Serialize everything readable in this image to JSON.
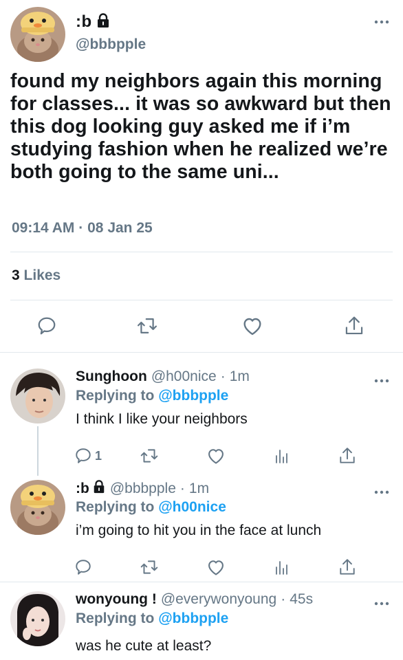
{
  "main_tweet": {
    "display_name": ":b",
    "handle": "@bbbpple",
    "text": "found my neighbors again this morning for classes... it was so awkward but then this dog looking guy asked me if i’m studying fashion when he realized we’re both going to the same uni...",
    "time": "09:14 AM",
    "date": "08 Jan 25",
    "likes_count": "3",
    "likes_label": "Likes",
    "avatar_icon": "cat-with-hat-avatar",
    "lock_icon": "lock-icon"
  },
  "replies": [
    {
      "name": "Sunghoon",
      "handle": "@h00nice",
      "time": "1m",
      "replying_prefix": "Replying to",
      "replying_to": "@bbbpple",
      "text": "I think I like your neighbors",
      "reply_count": "1"
    },
    {
      "name": ":b",
      "handle": "@bbbpple",
      "time": "1m",
      "replying_prefix": "Replying to",
      "replying_to": "@h00nice",
      "text": "i’m going to hit you in the face at lunch",
      "reply_count": ""
    },
    {
      "name": "wonyoung !",
      "handle": "@everywonyoung",
      "time": "45s",
      "replying_prefix": "Replying to",
      "replying_to": "@bbbpple",
      "text": "was he cute at least?",
      "reply_count": ""
    }
  ],
  "separator": "·",
  "colors": {
    "text": "#14171a",
    "secondary": "#657786",
    "link": "#1da1f2",
    "divider": "#e1e8ed"
  }
}
